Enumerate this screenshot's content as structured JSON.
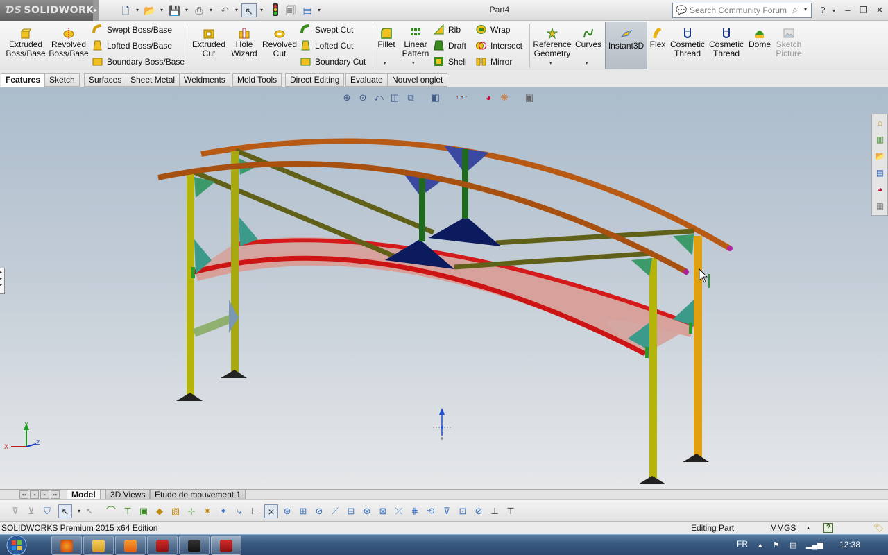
{
  "app": {
    "brand": "SOLIDWORKS",
    "document_title": "Part4"
  },
  "search": {
    "placeholder": "Search Community Forum",
    "value": "Search Community Forum"
  },
  "ribbon": {
    "extruded_boss": "Extruded\nBoss/Base",
    "revolved_boss": "Revolved\nBoss/Base",
    "swept_boss": "Swept Boss/Base",
    "lofted_boss": "Lofted Boss/Base",
    "boundary_boss": "Boundary Boss/Base",
    "extruded_cut": "Extruded\nCut",
    "hole_wizard": "Hole\nWizard",
    "revolved_cut": "Revolved\nCut",
    "swept_cut": "Swept Cut",
    "lofted_cut": "Lofted Cut",
    "boundary_cut": "Boundary Cut",
    "fillet": "Fillet",
    "linear_pattern": "Linear\nPattern",
    "rib": "Rib",
    "draft": "Draft",
    "shell": "Shell",
    "wrap": "Wrap",
    "intersect": "Intersect",
    "mirror": "Mirror",
    "reference_geometry": "Reference\nGeometry",
    "curves": "Curves",
    "instant3d": "Instant3D",
    "flex": "Flex",
    "cosmetic_thread_1": "Cosmetic\nThread",
    "cosmetic_thread_2": "Cosmetic\nThread",
    "dome": "Dome",
    "sketch_picture": "Sketch\nPicture"
  },
  "tabs": [
    "Features",
    "Sketch",
    "Surfaces",
    "Sheet Metal",
    "Weldments",
    "Mold Tools",
    "Direct Editing",
    "Evaluate",
    "Nouvel onglet"
  ],
  "bottom_tabs": [
    "Model",
    "3D Views",
    "Etude de mouvement 1"
  ],
  "triad": {
    "x": "X",
    "y": "Y",
    "z": "Z"
  },
  "status": {
    "app": "SOLIDWORKS Premium 2015 x64 Edition",
    "mode": "Editing Part",
    "units": "MMGS",
    "help": "?"
  },
  "taskbar": {
    "lang": "FR",
    "time": "12:38"
  },
  "colors": {
    "beam_orange": "#b85a14",
    "post_yellow": "#b4b40a",
    "deck_red": "#d01818",
    "deck_fill": "#d9a09a",
    "brace_olive": "#606018",
    "gusset_navy": "#0c1a5e",
    "taskbar_blue": "#2c4870"
  }
}
